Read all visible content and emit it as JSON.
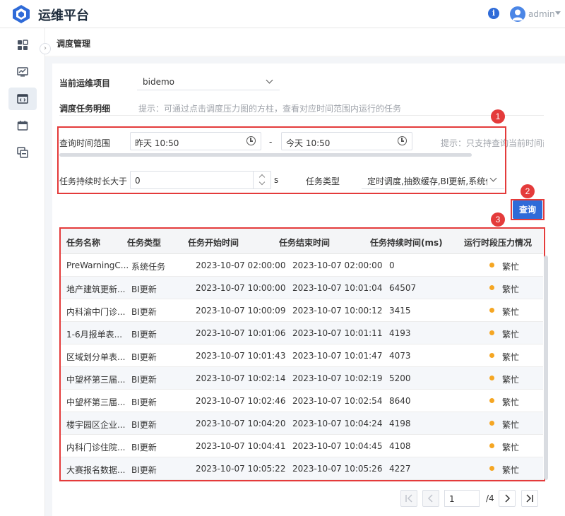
{
  "header": {
    "app_title": "运维平台",
    "user_name": "admin",
    "info_icon": "info-icon",
    "colors": {
      "brand": "#2f6bd8"
    }
  },
  "sidebar": {
    "items": [
      {
        "icon": "dashboard-icon"
      },
      {
        "icon": "monitor-icon"
      },
      {
        "icon": "code-window-icon"
      },
      {
        "icon": "calendar-icon"
      },
      {
        "icon": "windows-icon"
      }
    ]
  },
  "breadcrumb": "调度管理",
  "form": {
    "project_label": "当前运维项目",
    "project_value": "bidemo",
    "detail_label": "调度任务明细",
    "detail_hint": "提示：可通过点击调度压力图的方柱，查看对应时间范围内运行的任务",
    "time_range_label": "查询时间范围",
    "start_time": "昨天   10:50",
    "range_sep": "-",
    "end_time": "今天   10:50",
    "time_hint": "提示：只支持查询当前时间前",
    "duration_label": "任务持续时长大于",
    "duration_value": "0",
    "duration_unit": "s",
    "type_label": "任务类型",
    "type_value": "定时调度,抽数缓存,BI更新,系统任务",
    "query_button": "查询"
  },
  "annotations": [
    "1",
    "2",
    "3"
  ],
  "table": {
    "headers": [
      "任务名称",
      "任务类型",
      "任务开始时间",
      "任务结束时间",
      "任务持续时间(ms)",
      "运行时段压力情况"
    ],
    "rows": [
      [
        "PreWarningC...",
        "系统任务",
        "2023-10-07 02:00:00",
        "2023-10-07 02:00:00",
        "0",
        "繁忙"
      ],
      [
        "地产建筑更新...",
        "BI更新",
        "2023-10-07 10:00:00",
        "2023-10-07 10:01:04",
        "64507",
        "繁忙"
      ],
      [
        "内科渝中门诊...",
        "BI更新",
        "2023-10-07 10:00:09",
        "2023-10-07 10:00:12",
        "3415",
        "繁忙"
      ],
      [
        "1-6月报单表...",
        "BI更新",
        "2023-10-07 10:01:06",
        "2023-10-07 10:01:11",
        "4193",
        "繁忙"
      ],
      [
        "区域划分单表...",
        "BI更新",
        "2023-10-07 10:01:43",
        "2023-10-07 10:01:47",
        "4073",
        "繁忙"
      ],
      [
        "中望杯第三届...",
        "BI更新",
        "2023-10-07 10:02:14",
        "2023-10-07 10:02:19",
        "5200",
        "繁忙"
      ],
      [
        "中望杯第三届...",
        "BI更新",
        "2023-10-07 10:02:46",
        "2023-10-07 10:02:54",
        "8640",
        "繁忙"
      ],
      [
        "楼宇园区企业...",
        "BI更新",
        "2023-10-07 10:04:20",
        "2023-10-07 10:04:24",
        "4198",
        "繁忙"
      ],
      [
        "内科门诊住院...",
        "BI更新",
        "2023-10-07 10:04:41",
        "2023-10-07 10:04:45",
        "4108",
        "繁忙"
      ],
      [
        "大赛报名数据...",
        "BI更新",
        "2023-10-07 10:05:22",
        "2023-10-07 10:05:26",
        "4227",
        "繁忙"
      ]
    ],
    "status_color": "#f5a623"
  },
  "pagination": {
    "current": "1",
    "total": "/4"
  }
}
